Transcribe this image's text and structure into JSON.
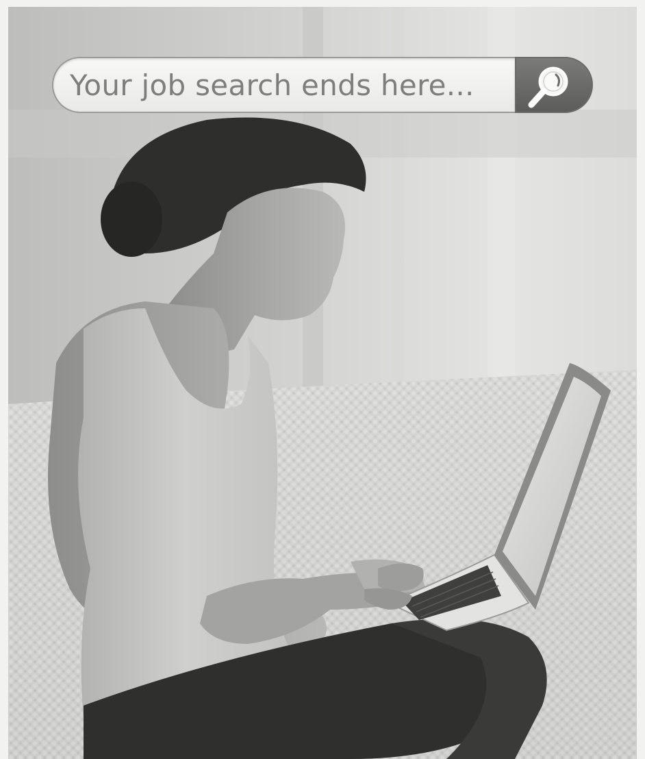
{
  "search": {
    "placeholder": "Your job search ends here...",
    "button_icon": "magnifier-icon"
  },
  "photo": {
    "icon": "woman-using-laptop-photo"
  },
  "colors": {
    "search_field": "#f2f2f0",
    "search_text": "#7e7e7c",
    "search_button": "#6a6a68",
    "photo_tone": "#cfcfcd"
  }
}
